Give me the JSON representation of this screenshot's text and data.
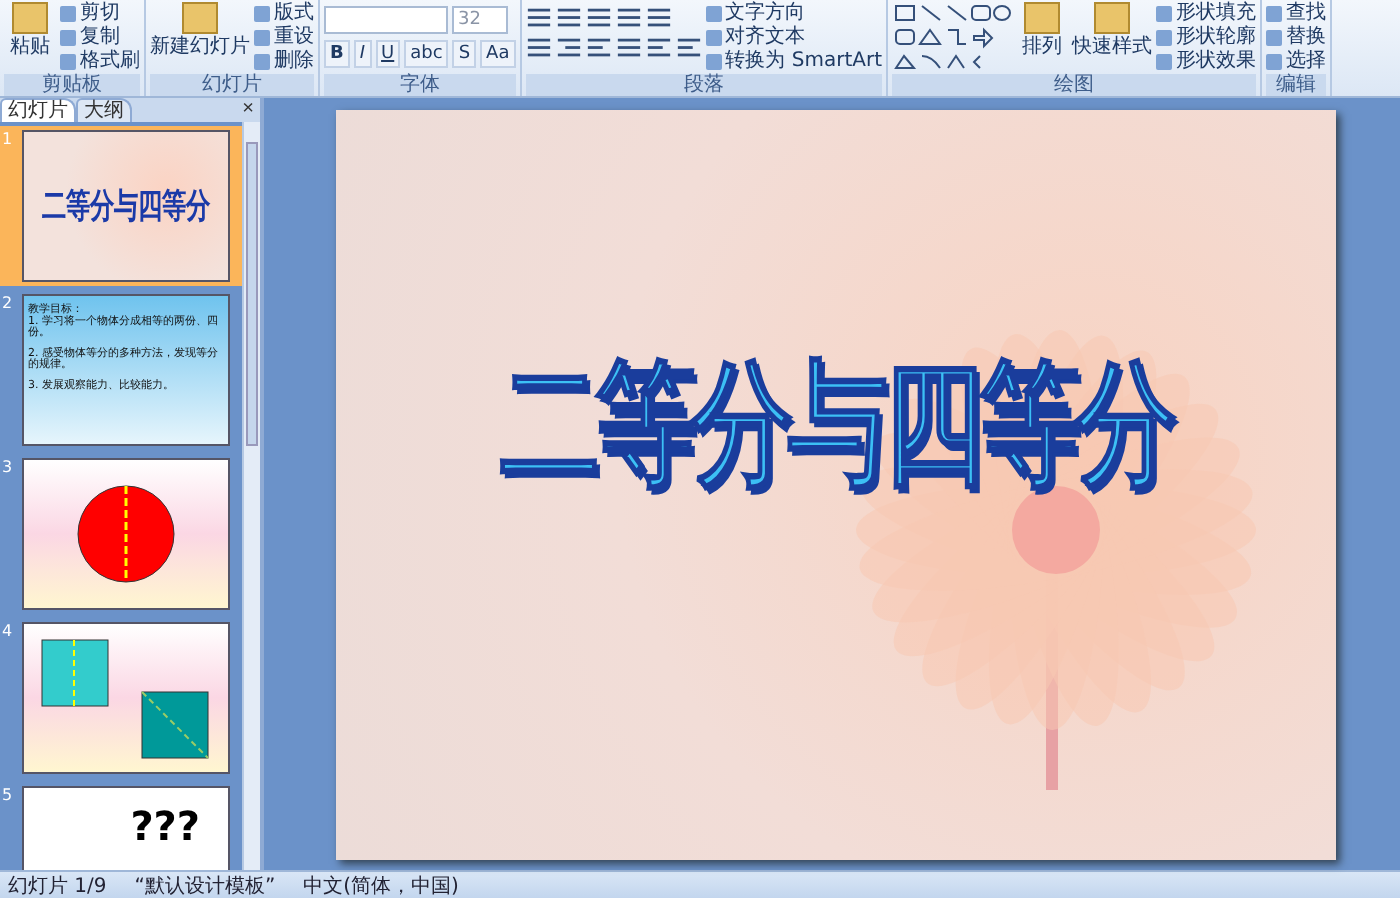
{
  "ribbon": {
    "groups": [
      {
        "kind": "clipboard",
        "label": "剪贴板",
        "large": [
          {
            "label": "粘贴"
          }
        ],
        "small": [
          "剪切",
          "复制",
          "格式刷"
        ]
      },
      {
        "kind": "slides",
        "label": "幻灯片",
        "large": [
          {
            "label": "新建幻灯片"
          }
        ],
        "small": [
          "版式",
          "重设",
          "删除"
        ]
      },
      {
        "kind": "font",
        "label": "字体",
        "font_size": "32",
        "buttons": [
          "B",
          "I",
          "U",
          "abc",
          "S",
          "Aa"
        ]
      },
      {
        "kind": "paragraph",
        "label": "段落",
        "small": [
          "文字方向",
          "对齐文本",
          "转换为 SmartArt"
        ]
      },
      {
        "kind": "drawing",
        "label": "绘图",
        "large": [
          {
            "label": "排列"
          },
          {
            "label": "快速样式"
          }
        ],
        "small": [
          "形状填充",
          "形状轮廓",
          "形状效果"
        ]
      },
      {
        "kind": "editing",
        "label": "编辑",
        "small": [
          "查找",
          "替换",
          "选择"
        ]
      }
    ]
  },
  "panel": {
    "tabs": [
      {
        "label": "幻灯片",
        "selected": true
      },
      {
        "label": "大纲",
        "selected": false
      }
    ],
    "close": "×",
    "slides": [
      {
        "number": "1",
        "kind": "title",
        "selected": true,
        "texts": [
          "二等分与四等分"
        ]
      },
      {
        "number": "2",
        "kind": "text",
        "selected": false,
        "texts": [
          "教学目标：",
          "1. 学习将一个物体分成相等的两份、四份。",
          "2. 感受物体等分的多种方法，发现等分的规律。",
          "3. 发展观察能力、比较能力。"
        ]
      },
      {
        "number": "3",
        "kind": "circle",
        "selected": false
      },
      {
        "number": "4",
        "kind": "squares",
        "selected": false
      },
      {
        "number": "5",
        "kind": "question",
        "selected": false,
        "texts": [
          "???"
        ]
      }
    ]
  },
  "slide": {
    "title": "二等分与四等分"
  },
  "status_bar": {
    "slide": "幻灯片 1/9",
    "theme": "“默认设计模板”",
    "language": "中文(简体，中国)"
  }
}
